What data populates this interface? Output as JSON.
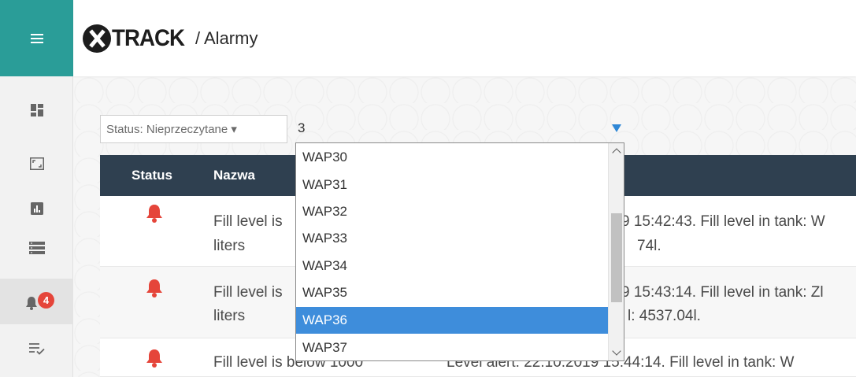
{
  "app": {
    "logo_text": "TRACK",
    "breadcrumb": "/ Alarmy"
  },
  "sidebar": {
    "items": [
      {
        "icon": "dashboard-icon"
      },
      {
        "icon": "fullscreen-icon"
      },
      {
        "icon": "chart-icon"
      },
      {
        "icon": "list-icon"
      },
      {
        "icon": "bell-icon",
        "badge": "4",
        "active": true
      },
      {
        "icon": "checklist-icon"
      }
    ]
  },
  "filters": {
    "status_label": "Status: Nieprzeczytane ▾",
    "search_value": "3"
  },
  "table": {
    "headers": [
      "Status",
      "Nazwa"
    ],
    "rows": [
      {
        "name_line1": "Fill level is",
        "name_line2": "liters",
        "msg_line1": "9 15:42:43. Fill level in tank: W",
        "msg_line2": "74l."
      },
      {
        "name_line1": "Fill level is",
        "name_line2": "liters",
        "msg_line1": "9 15:43:14. Fill level in tank: Zl",
        "msg_line2": "l: 4537.04l."
      },
      {
        "name_line1": "Fill level is below 1000",
        "msg_line1": "Level alert: 22.10.2019 15:44:14. Fill level in tank: W"
      }
    ]
  },
  "dropdown": {
    "options": [
      "WAP30",
      "WAP31",
      "WAP32",
      "WAP33",
      "WAP34",
      "WAP35",
      "WAP36",
      "WAP37"
    ],
    "selected": "WAP36"
  },
  "colors": {
    "accent": "#2a9d98",
    "table_header": "#2f4050",
    "selected": "#3e8ddb",
    "alarm": "#e5453a"
  }
}
